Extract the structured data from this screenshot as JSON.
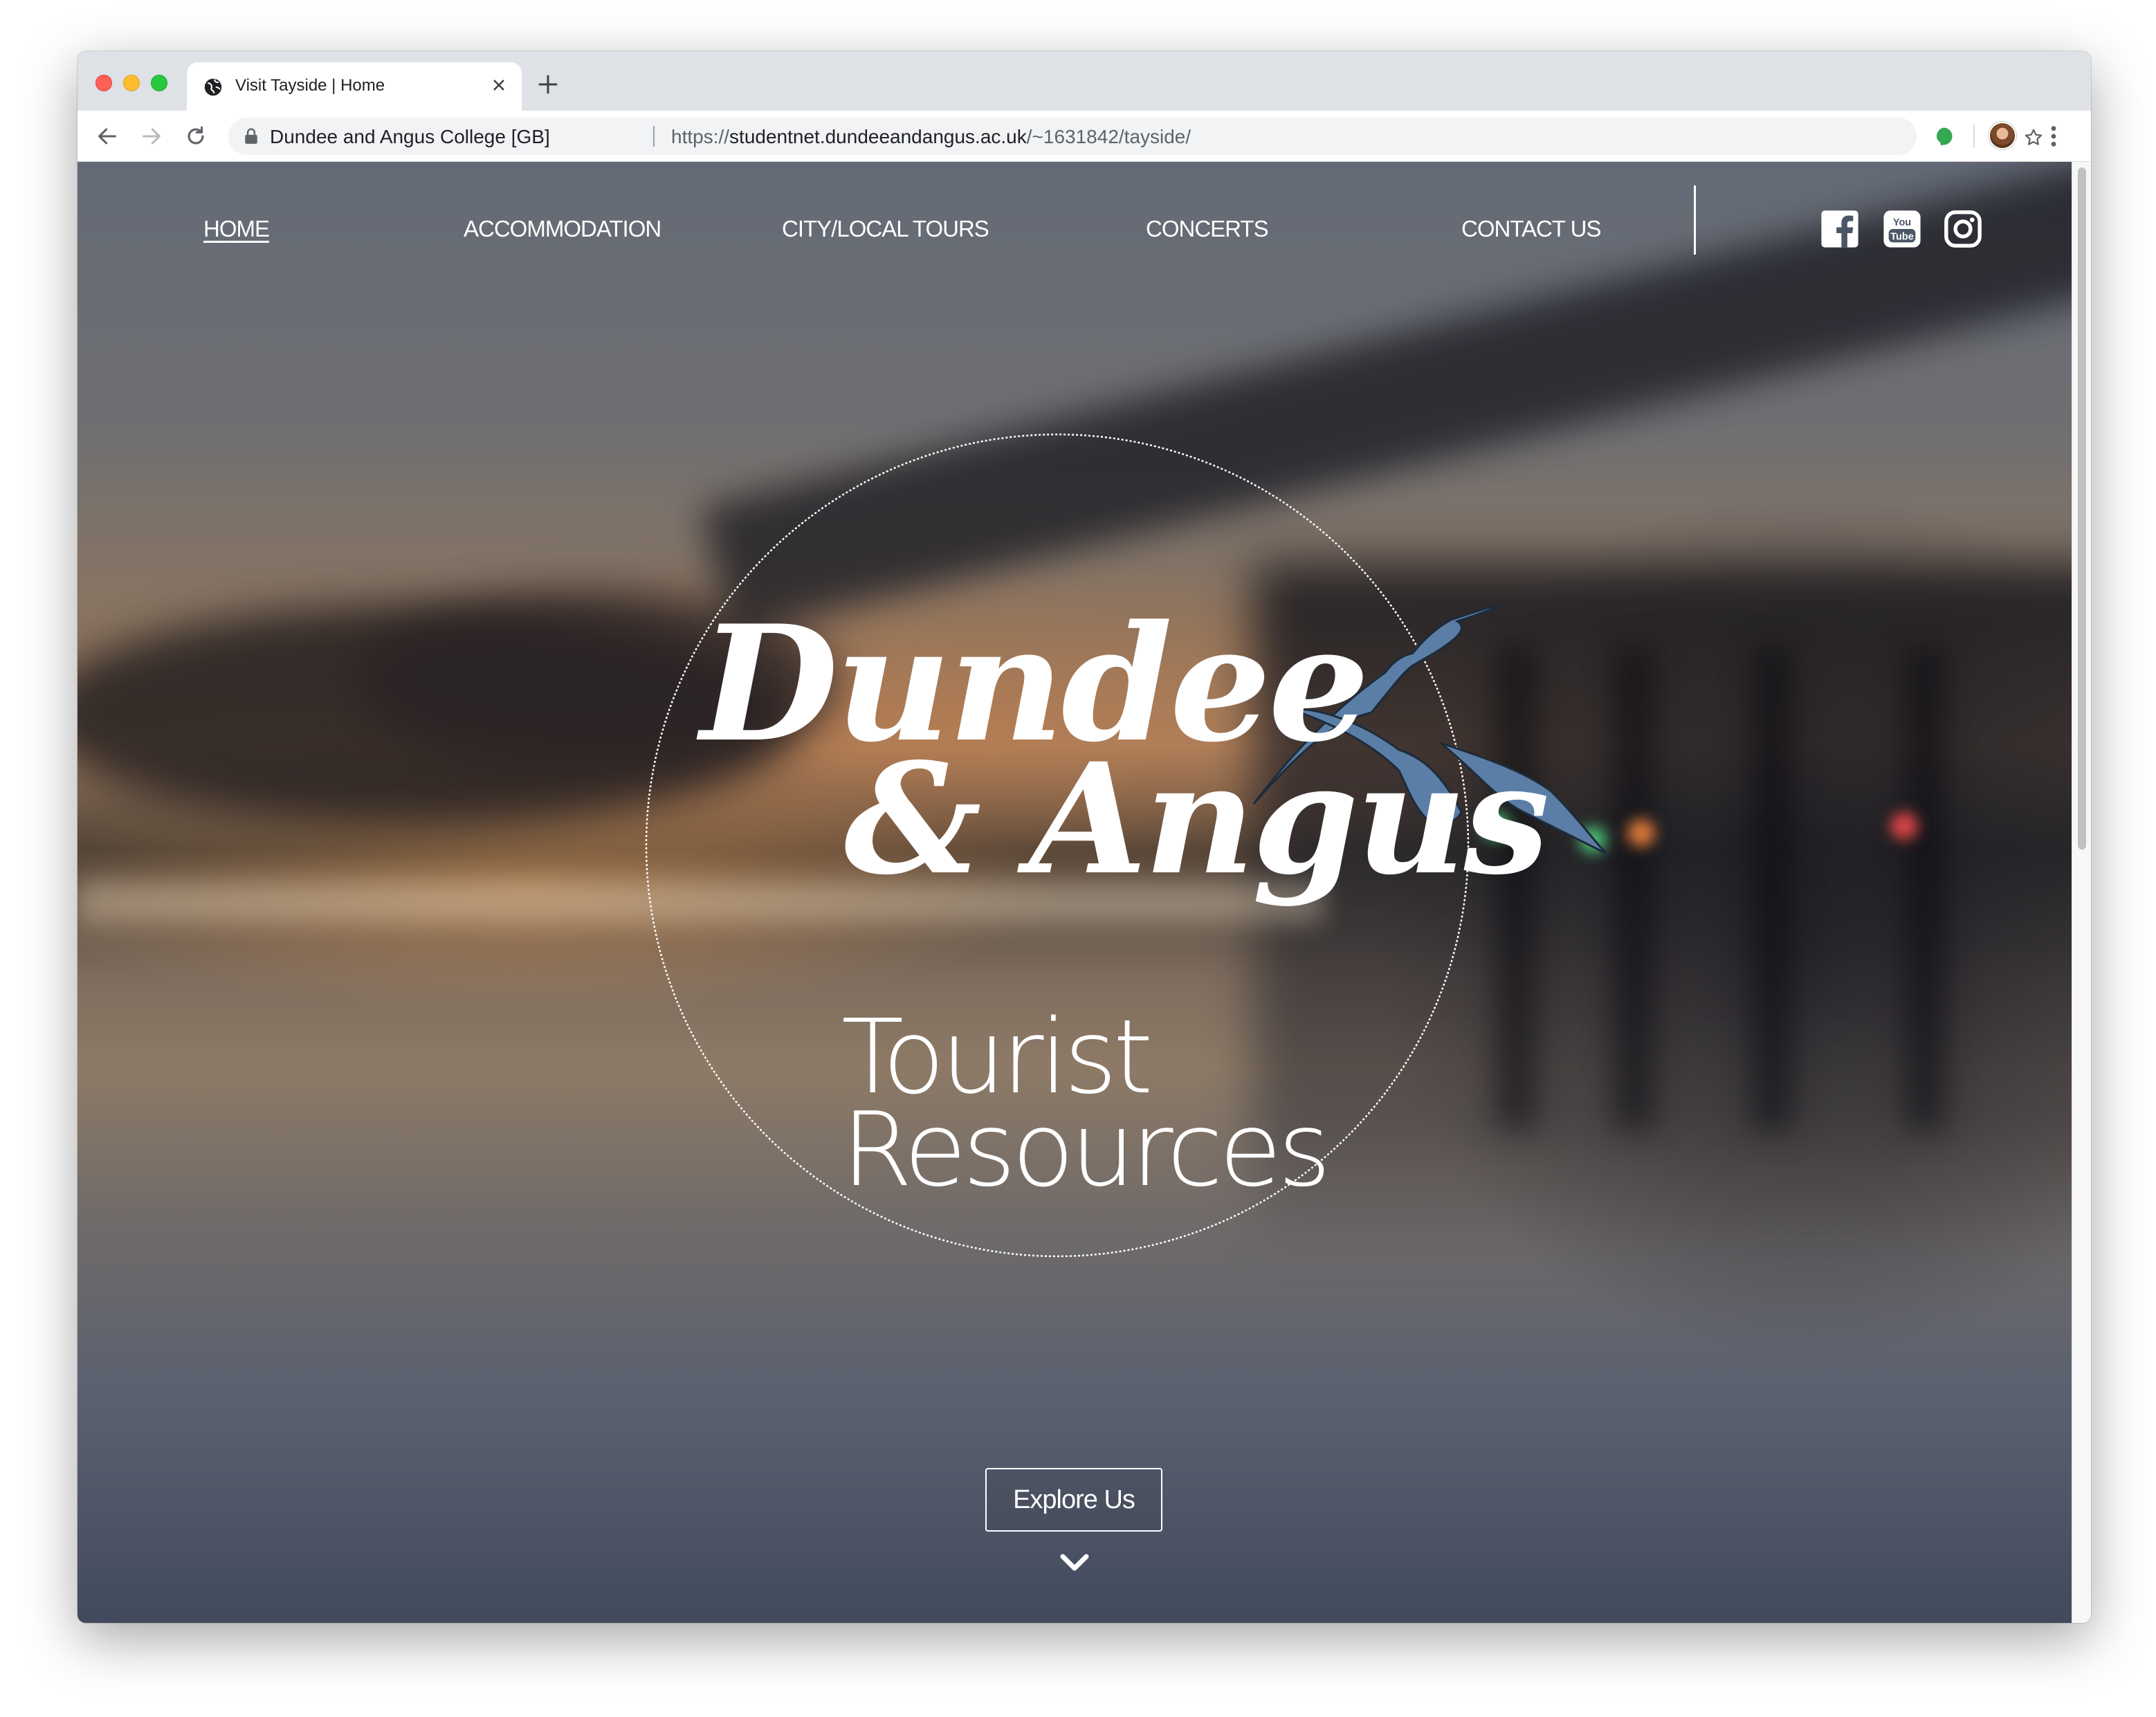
{
  "browser": {
    "tab_title": "Visit Tayside | Home",
    "site_identity": "Dundee and Angus College [GB]",
    "url_scheme": "https://",
    "url_host": "studentnet.dundeeandangus.ac.uk",
    "url_path": "/~1631842/tayside/"
  },
  "nav": {
    "items": [
      {
        "label": "HOME",
        "active": true
      },
      {
        "label": "ACCOMMODATION",
        "active": false
      },
      {
        "label": "CITY/LOCAL TOURS",
        "active": false
      },
      {
        "label": "CONCERTS",
        "active": false
      },
      {
        "label": "CONTACT US",
        "active": false
      }
    ],
    "social": [
      "facebook-icon",
      "youtube-icon",
      "instagram-icon"
    ]
  },
  "hero": {
    "title_line1": "Dundee",
    "title_line2": "& Angus",
    "subtitle_line1": "Tourist",
    "subtitle_line2": "Resources",
    "cta_label": "Explore Us"
  },
  "colors": {
    "bird_fill": "#5a7ea6",
    "nav_text": "#ffffff"
  }
}
